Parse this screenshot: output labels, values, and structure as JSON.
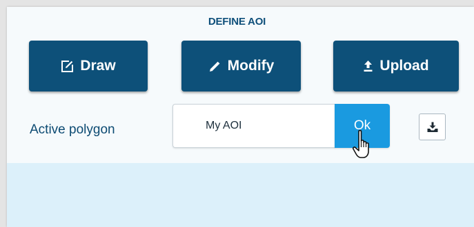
{
  "panel": {
    "title": "DEFINE AOI"
  },
  "tools": {
    "draw_label": "Draw",
    "modify_label": "Modify",
    "upload_label": "Upload"
  },
  "active_polygon": {
    "label": "Active polygon",
    "name_value": "My AOI",
    "ok_label": "Ok"
  },
  "icons": {
    "draw": "edit-square-icon",
    "modify": "pencil-icon",
    "upload": "upload-icon",
    "download": "download-icon",
    "cursor": "hand-pointer-cursor"
  },
  "colors": {
    "primary": "#0d5079",
    "accent": "#1a9ae0",
    "map_background": "#dcf0fa",
    "label": "#0c4a72"
  }
}
